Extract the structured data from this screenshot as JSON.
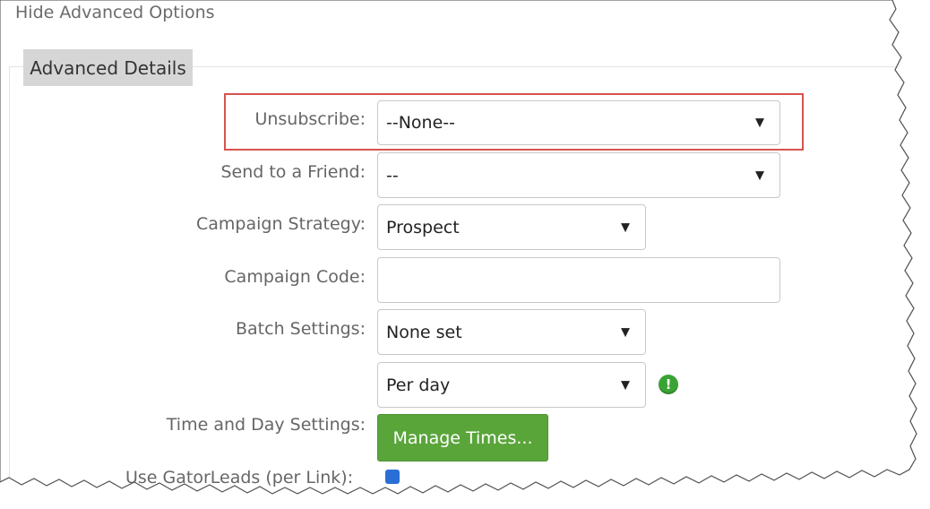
{
  "header": {
    "hide_link": "Hide Advanced Options"
  },
  "tab": {
    "label": "Advanced Details"
  },
  "form": {
    "unsubscribe": {
      "label": "Unsubscribe:",
      "value": "--None--"
    },
    "send_to_friend": {
      "label": "Send to a Friend:",
      "value": "--"
    },
    "campaign_strategy": {
      "label": "Campaign Strategy:",
      "value": "Prospect"
    },
    "campaign_code": {
      "label": "Campaign Code:",
      "value": ""
    },
    "batch_settings": {
      "label": "Batch Settings:",
      "value": "None set",
      "period_value": "Per day"
    },
    "time_day": {
      "label": "Time and Day Settings:",
      "button": "Manage Times..."
    },
    "gatorleads": {
      "label": "Use GatorLeads (per Link):"
    }
  },
  "icons": {
    "caret": "▼",
    "info": "!"
  },
  "colors": {
    "highlight": "#d9534f",
    "button": "#5aa53a",
    "info": "#3aa335"
  }
}
